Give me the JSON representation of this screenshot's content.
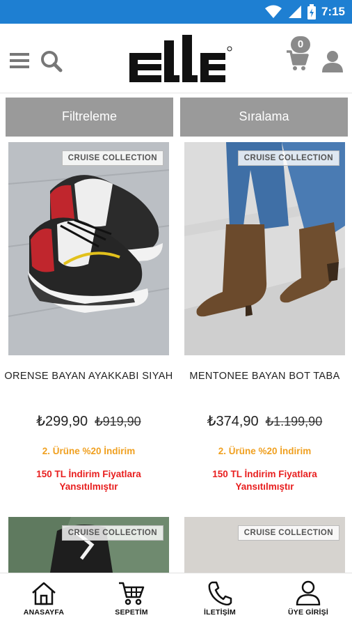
{
  "status_bar": {
    "time": "7:15"
  },
  "header": {
    "cart_count": "0"
  },
  "filters": {
    "filter_label": "Filtreleme",
    "sort_label": "Sıralama"
  },
  "products": [
    {
      "tag": "CRUISE COLLECTION",
      "name": "ORENSE BAYAN AYAKKABI SIYAH",
      "price": "₺299,90",
      "old_price": "₺919,90",
      "promo": "2. Ürüne %20 İndirim",
      "note": "150 TL İndirim Fiyatlara Yansıtılmıştır"
    },
    {
      "tag": "CRUISE COLLECTION",
      "name": "MENTONEE BAYAN BOT TABA",
      "price": "₺374,90",
      "old_price": "₺1.199,90",
      "promo": "2. Ürüne %20 İndirim",
      "note": "150 TL İndirim Fiyatlara Yansıtılmıştır"
    },
    {
      "tag": "CRUISE COLLECTION"
    },
    {
      "tag": "CRUISE COLLECTION"
    }
  ],
  "bottom_nav": [
    {
      "label": "ANASAYFA",
      "icon": "home-icon"
    },
    {
      "label": "SEPETİM",
      "icon": "cart-icon"
    },
    {
      "label": "İLETİŞİM",
      "icon": "phone-icon"
    },
    {
      "label": "ÜYE GİRİŞİ",
      "icon": "user-icon"
    }
  ],
  "colors": {
    "status_bar": "#1e7fd2",
    "filter_button": "#9a9a9a",
    "promo": "#f0a020",
    "note": "#e81e1e"
  }
}
